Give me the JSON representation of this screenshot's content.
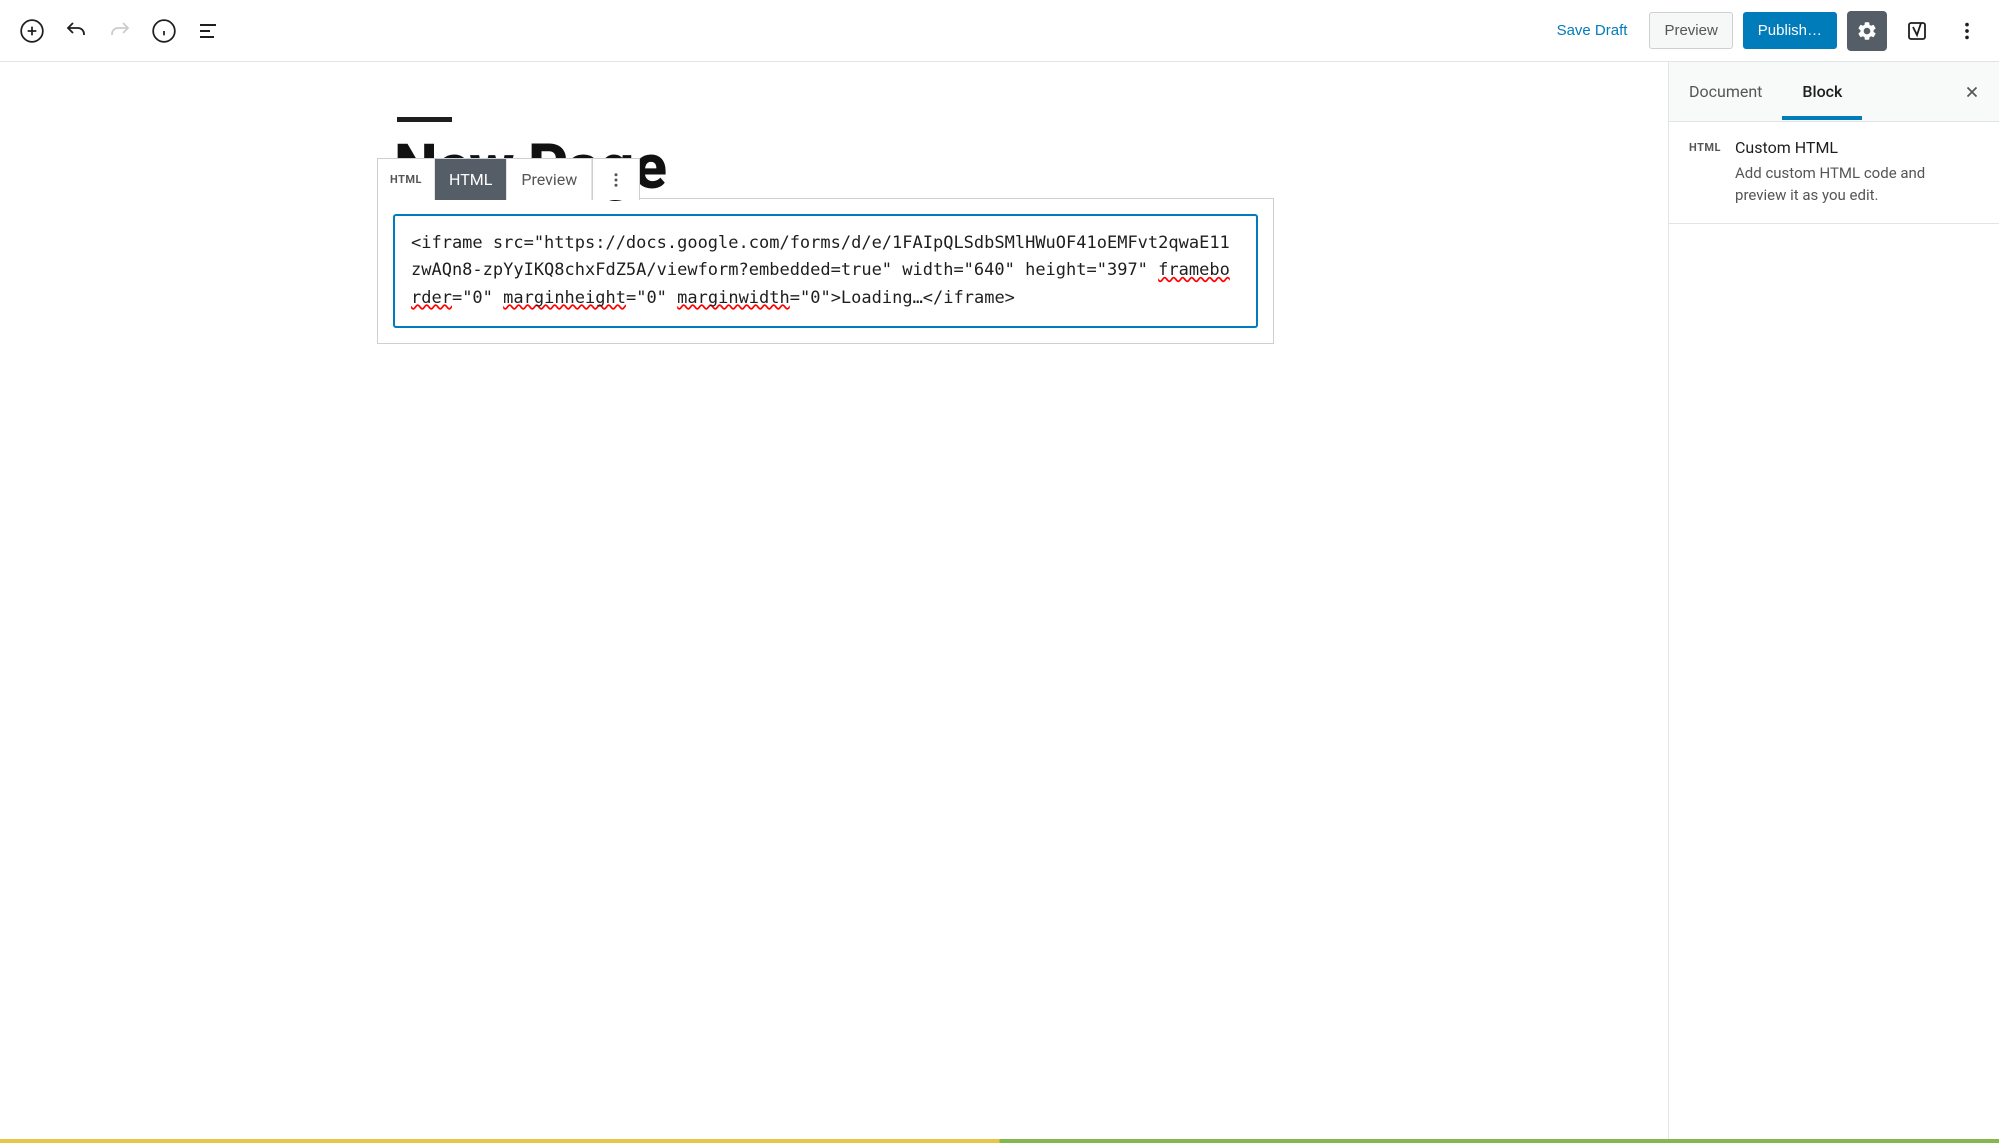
{
  "toolbar": {
    "save_draft": "Save Draft",
    "preview": "Preview",
    "publish": "Publish…"
  },
  "editor": {
    "page_title": "New Page",
    "block_toolbar": {
      "icon_label": "HTML",
      "html_tab": "HTML",
      "preview_tab": "Preview"
    },
    "html_code": {
      "part1": "<iframe src=\"https://docs.google.com/forms/d/e/1FAIpQLSdbSMlHWuOF41oEMFvt2qwaE11zwAQn8-zpYyIKQ8chxFdZ5A/viewform?embedded=true\" width=\"640\" height=\"397\" ",
      "err1": "frameborder",
      "part2": "=\"0\" ",
      "err2": "marginheight",
      "part3": "=\"0\" ",
      "err3": "marginwidth",
      "part4": "=\"0\">Loading…</iframe>"
    }
  },
  "sidebar": {
    "tab_document": "Document",
    "tab_block": "Block",
    "block_card": {
      "icon_label": "HTML",
      "title": "Custom HTML",
      "description": "Add custom HTML code and preview it as you edit."
    }
  }
}
